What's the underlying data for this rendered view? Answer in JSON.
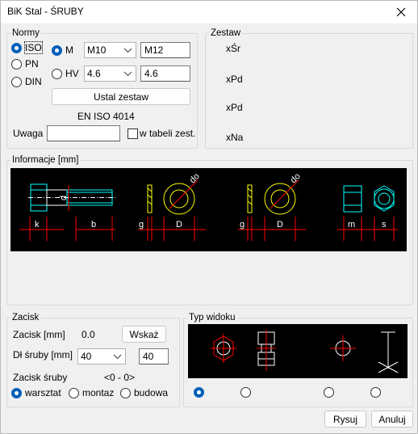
{
  "window": {
    "title": "BiK Stal - ŚRUBY"
  },
  "normy": {
    "legend": "Normy",
    "options": [
      "ISO",
      "PN",
      "DIN"
    ],
    "selected": "ISO",
    "class_options": [
      "M",
      "HV"
    ],
    "class_selected": "M",
    "m_select": "M10",
    "m_value": "M12",
    "hv_select": "4.6",
    "hv_value": "4.6",
    "set_button": "Ustal zestaw",
    "norm_label": "EN ISO 4014",
    "uwaga_label": "Uwaga",
    "uwaga_value": "",
    "checkbox_label": "w tabeli zest.",
    "checkbox_checked": false
  },
  "zestaw": {
    "legend": "Zestaw",
    "items": [
      "xŚr",
      "xPd",
      "xPd",
      "xNa"
    ]
  },
  "info": {
    "legend": "Informacje [mm]",
    "dim_labels": [
      "k",
      "b",
      "d",
      "g",
      "D",
      "do",
      "g",
      "D",
      "do",
      "m",
      "s"
    ]
  },
  "zacisk": {
    "legend": "Zacisk",
    "zacisk_label": "Zacisk [mm]",
    "zacisk_value": "0.0",
    "show_button": "Wskaż",
    "length_label": "Dł śruby [mm]",
    "length_select": "40",
    "length_value": "40",
    "screw_label": "Zacisk śruby",
    "screw_range": "<0 - 0>",
    "modes": [
      "warsztat",
      "montaz",
      "budowa"
    ],
    "mode_selected": "warsztat"
  },
  "typ": {
    "legend": "Typ widoku",
    "selected_index": 0
  },
  "footer": {
    "draw_button": "Rysuj",
    "cancel_button": "Anuluj"
  },
  "colors": {
    "accent": "#005fb8",
    "cad_cyan": "#00ffff",
    "cad_red": "#ff0000",
    "cad_yellow": "#ffff00",
    "cad_white": "#ffffff"
  }
}
